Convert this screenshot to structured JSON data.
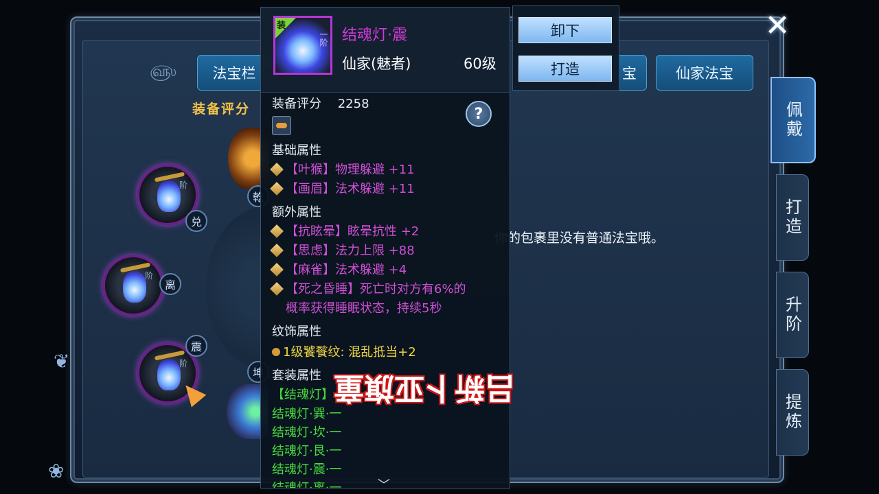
{
  "window": {
    "close_icon": "close-icon",
    "tabs": {
      "fabao_bar": "法宝栏",
      "hidden_tab_partial": "宝",
      "xianjia_fabao": "仙家法宝"
    },
    "equip_score_label": "装备评分"
  },
  "slots": {
    "trigrams": [
      "乾",
      "兑",
      "离",
      "震",
      "坤"
    ]
  },
  "side_tabs": [
    "佩戴",
    "打造",
    "升阶",
    "提炼"
  ],
  "right_panel": {
    "empty_message": "你的包裹里没有普通法宝哦。"
  },
  "tooltip": {
    "item": {
      "badge": "装",
      "grade": "一阶",
      "name": "结魂灯·震",
      "class": "仙家(魅者)",
      "level": "60级"
    },
    "score_label": "装备评分",
    "score_value": "2258",
    "help_icon": "?",
    "sections": {
      "basic_title": "基础属性",
      "basic": [
        "【叶猴】物理躲避 +11",
        "【画眉】法术躲避 +11"
      ],
      "extra_title": "额外属性",
      "extra": [
        "【抗眩晕】眩晕抗性 +2",
        "【思虑】法力上限 +88",
        "【麻雀】法术躲避 +4"
      ],
      "extra_long_1": "【死之昏睡】死亡时对方有6%的",
      "extra_long_2": "概率获得睡眠状态，持续5秒",
      "pattern_title": "纹饰属性",
      "pattern": "1级饕餮纹: 混乱抵当+2",
      "set_title": "套装属性",
      "set_name": "【结魂灯】",
      "set_items": [
        "结魂灯·巽·一",
        "结魂灯·坎·一",
        "结魂灯·艮·一",
        "结魂灯·震·一",
        "结魂灯·离·一"
      ]
    },
    "scroll_icon": "chevron-down-icon"
  },
  "actions": {
    "unequip": "卸下",
    "forge": "打造"
  },
  "overlay": {
    "subtitle": "吕新卜亚旗童"
  }
}
